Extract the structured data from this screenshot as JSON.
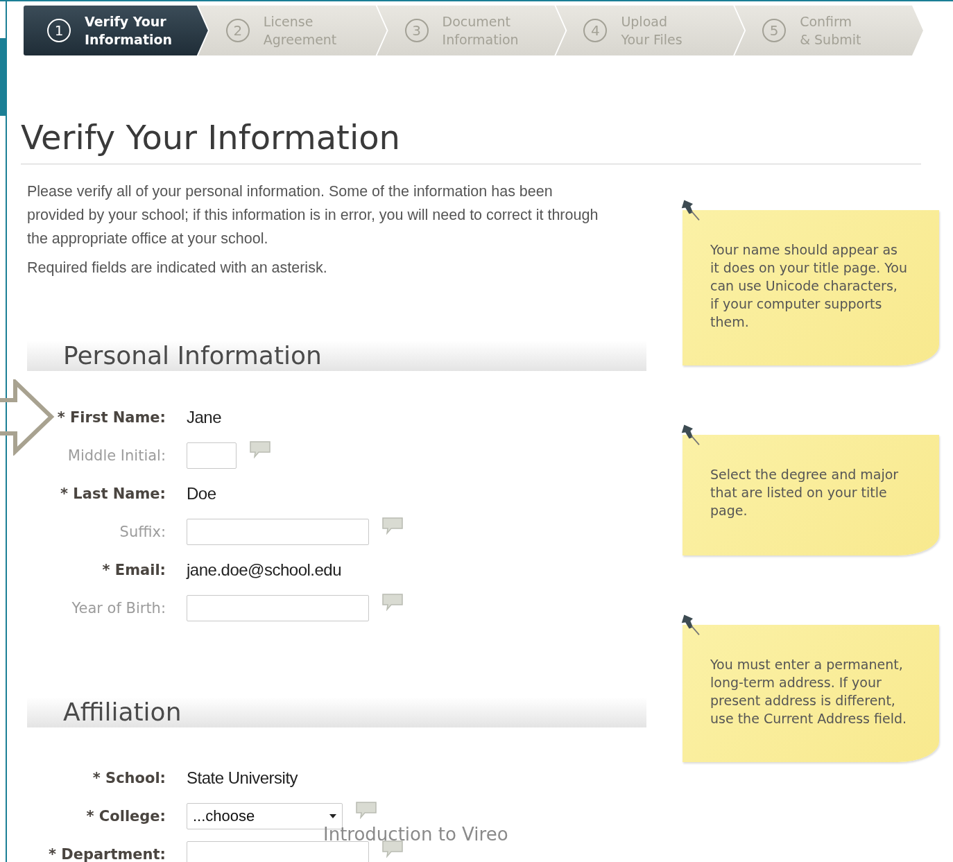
{
  "steps": [
    {
      "number": "1",
      "lines": [
        "Verify Your",
        "Information"
      ],
      "selected": true
    },
    {
      "number": "2",
      "lines": [
        "License",
        "Agreement"
      ],
      "selected": false
    },
    {
      "number": "3",
      "lines": [
        "Document",
        "Information"
      ],
      "selected": false
    },
    {
      "number": "4",
      "lines": [
        "Upload",
        "Your Files"
      ],
      "selected": false
    },
    {
      "number": "5",
      "lines": [
        "Confirm",
        "& Submit"
      ],
      "selected": false
    }
  ],
  "page_title": "Verify Your Information",
  "intro": [
    "Please verify all of your personal information. Some of the information has been provided by your school; if this information is in error, you will need to correct it through the appropriate office at your school.",
    "Required fields are indicated with an asterisk."
  ],
  "sections": [
    {
      "title": "Personal Information",
      "fields": [
        {
          "label": "First Name:",
          "required": true,
          "mark": "*",
          "kind": "value",
          "value": "Jane"
        },
        {
          "label": "Middle Initial:",
          "required": false,
          "kind": "short-input"
        },
        {
          "label": "Last Name:",
          "required": true,
          "mark": "*",
          "kind": "value",
          "value": "Doe"
        },
        {
          "label": "Suffix:",
          "required": false,
          "kind": "input"
        },
        {
          "label": "Email:",
          "required": true,
          "mark": "*",
          "kind": "value",
          "value": "jane.doe@school.edu"
        },
        {
          "label": "Year of Birth:",
          "required": false,
          "kind": "input"
        }
      ]
    },
    {
      "title": "Affiliation",
      "fields": [
        {
          "label": "School:",
          "required": true,
          "mark": "*",
          "kind": "value",
          "value": "State University"
        },
        {
          "label": "College:",
          "required": true,
          "mark": "*",
          "kind": "select",
          "value": "...choose"
        },
        {
          "label": "Department:",
          "required": true,
          "mark": "*",
          "kind": "input"
        }
      ]
    }
  ],
  "notes": [
    "Your name should appear as it does on your title page. You can use Unicode characters, if your computer supports them.",
    "Select the degree and major that are listed on your title page.",
    "You must enter a permanent, long-term address. If your present address is different, use the Current Address field."
  ],
  "footer": "Introduction to Vireo"
}
